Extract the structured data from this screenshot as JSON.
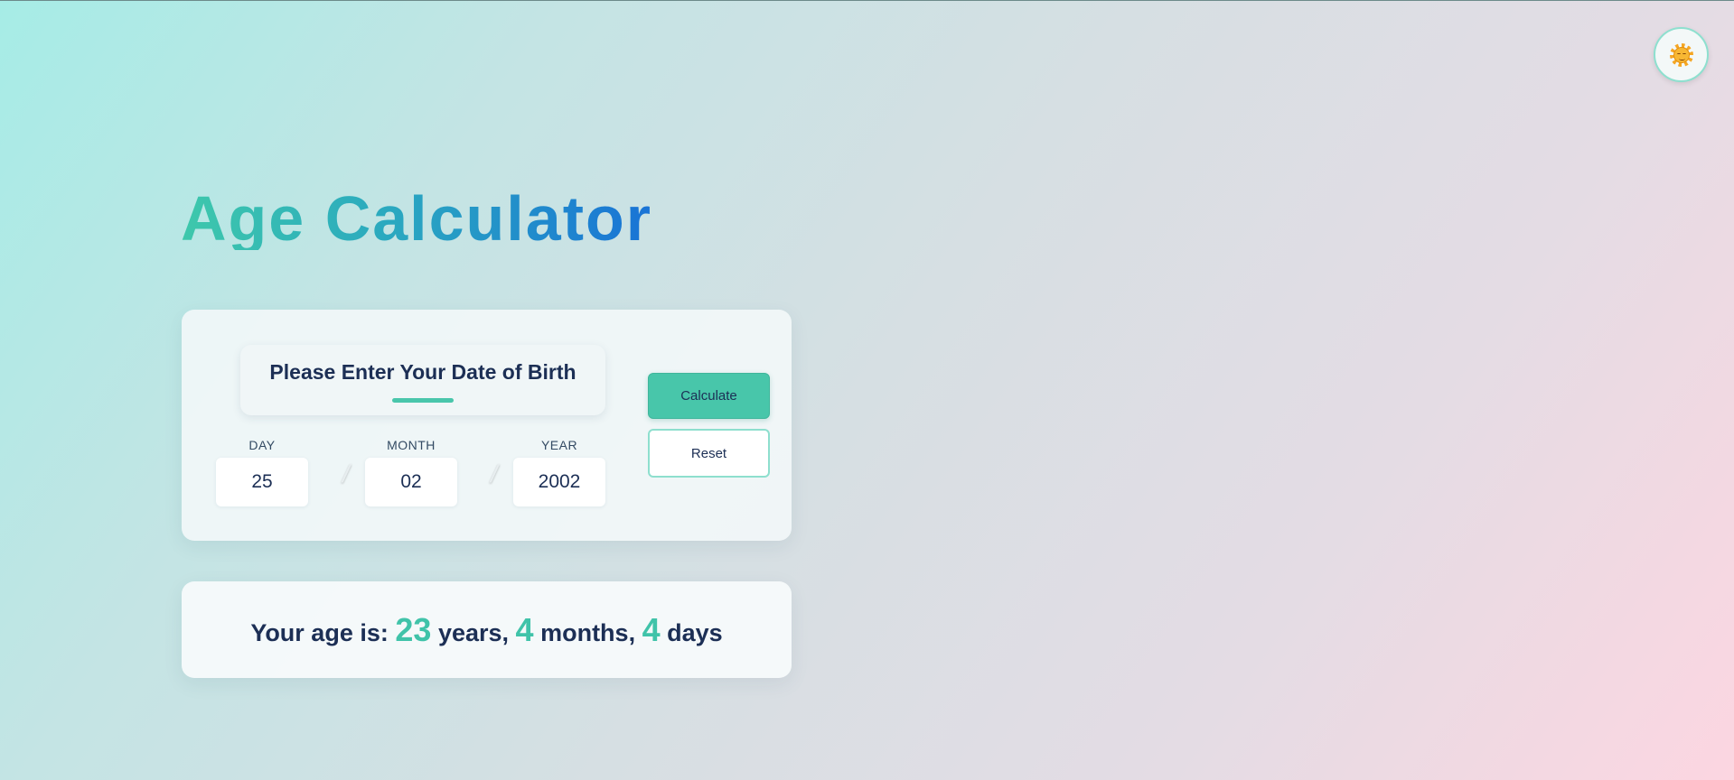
{
  "theme_toggle": {
    "icon": "sun-face-icon"
  },
  "title": "Age Calculator",
  "form": {
    "prompt": "Please Enter Your Date of Birth",
    "fields": [
      {
        "label": "DAY",
        "value": "25"
      },
      {
        "label": "MONTH",
        "value": "02"
      },
      {
        "label": "YEAR",
        "value": "2002"
      }
    ],
    "separator": "/",
    "calculate_label": "Calculate",
    "reset_label": "Reset"
  },
  "result": {
    "prefix": "Your age is:",
    "years": "23",
    "years_label": "years,",
    "months": "4",
    "months_label": "months,",
    "days": "4",
    "days_label": "days"
  },
  "colors": {
    "accent": "#48c6aa",
    "text": "#1c2f55",
    "title_gradient_start": "#3ec8ab",
    "title_gradient_end": "#1973d6"
  }
}
